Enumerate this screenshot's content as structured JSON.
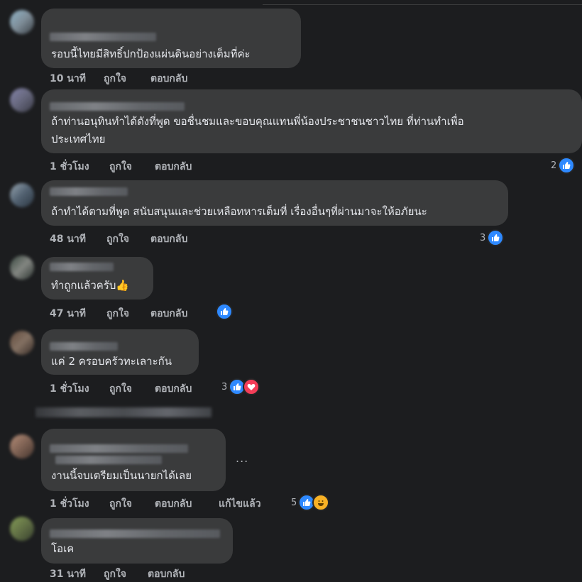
{
  "comments": [
    {
      "text_lines": [
        "รอบนี้ไทยมีสิทธิ์ปกป้องแผ่นดินอย่างเต็มที่ค่ะ"
      ],
      "time": "10 นาที",
      "like_label": "ถูกใจ",
      "reply_label": "ตอบกลับ",
      "reaction_count": ""
    },
    {
      "text_lines": [
        "ถ้าท่านอนุทินทำได้ดังที่พูด ขอชื่นชมและขอบคุณแทนพี่น้องประชาชนชาวไทย ที่ท่านทำเพื่อ",
        "ประเทศไทย"
      ],
      "time": "1 ชั่วโมง",
      "like_label": "ถูกใจ",
      "reply_label": "ตอบกลับ",
      "reaction_count": "2"
    },
    {
      "text_lines": [
        "ถ้าทำได้ตามที่พูด สนับสนุนและช่วยเหลือทหารเต็มที่ เรื่องอื่นๆที่ผ่านมาจะให้อภัยนะ"
      ],
      "time": "48 นาที",
      "like_label": "ถูกใจ",
      "reply_label": "ตอบกลับ",
      "reaction_count": "3"
    },
    {
      "text_lines": [
        "ทำถูกแล้วครับ"
      ],
      "emoji": "👍",
      "time": "47 นาที",
      "like_label": "ถูกใจ",
      "reply_label": "ตอบกลับ",
      "reaction_count": ""
    },
    {
      "text_lines": [
        "แค่ 2 ครอบครัวทะเลาะกัน"
      ],
      "time": "1 ชั่วโมง",
      "like_label": "ถูกใจ",
      "reply_label": "ตอบกลับ",
      "reaction_count": "3"
    },
    {
      "text_lines": [
        "งานนี้จบเตรียมเป็นนายกได้เลย"
      ],
      "time": "1 ชั่วโมง",
      "like_label": "ถูกใจ",
      "reply_label": "ตอบกลับ",
      "edited_label": "แก้ไขแล้ว",
      "reaction_count": "5",
      "more": "..."
    },
    {
      "text_lines": [
        "โอเค"
      ],
      "time": "31 นาที",
      "like_label": "ถูกใจ",
      "reply_label": "ตอบกลับ",
      "reaction_count": ""
    }
  ],
  "colors": {
    "background": "#1c1d1f",
    "bubble": "#3a3b3c",
    "like": "#2e89ff",
    "love": "#f33e58",
    "haha": "#f7b125",
    "meta_text": "#b0b3b8"
  }
}
